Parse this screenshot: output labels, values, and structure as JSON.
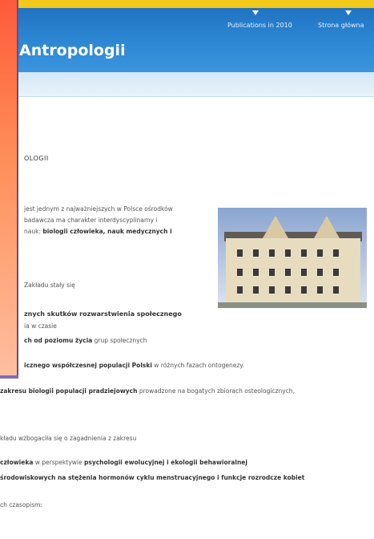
{
  "header": {
    "nav_items": [
      "Publications in 2010",
      "Strona główna"
    ],
    "site_title": "Antropologii"
  },
  "content": {
    "heading": "OLOGII",
    "para1": [
      "jest jednym z najważniejszych w Polsce ośrodków",
      "badawcza ma charakter interdyscyplinarny i",
      "nauk: "
    ],
    "para1_bold": "biologii człowieka, nauk medycznych i",
    "intro2": "Zakładu stały się",
    "items": [
      {
        "bold": "znych skutków rozwarstwienia społecznego",
        "text": ""
      },
      {
        "bold": "",
        "text": "ia w czasie"
      },
      {
        "bold": "ch od poziomu życia",
        "text": " grup społecznych"
      },
      {
        "bold": "icznego współczesnej populacji Polski",
        "text": " w różnych fazach ontogenezy."
      },
      {
        "bold": "zakresu biologii populacji pradziejowych",
        "text": " prowadzone na bogatych zbiorach osteologicznych,"
      }
    ],
    "intro3": "kładu wzbogaciła się o zagadnienia z zakresu",
    "items2": [
      {
        "bold": "człowieka",
        "text": " w perspektywie ",
        "bold2": "psychologii ewolucyjnej i ekologii behawioralnej"
      },
      {
        "bold": "środowiskowych na stężenia hormonów cyklu menstruacyjnego i funkcje rozrodcze kobiet",
        "text": "",
        "bold2": ""
      }
    ],
    "footer_text": "ch czasopism:"
  }
}
